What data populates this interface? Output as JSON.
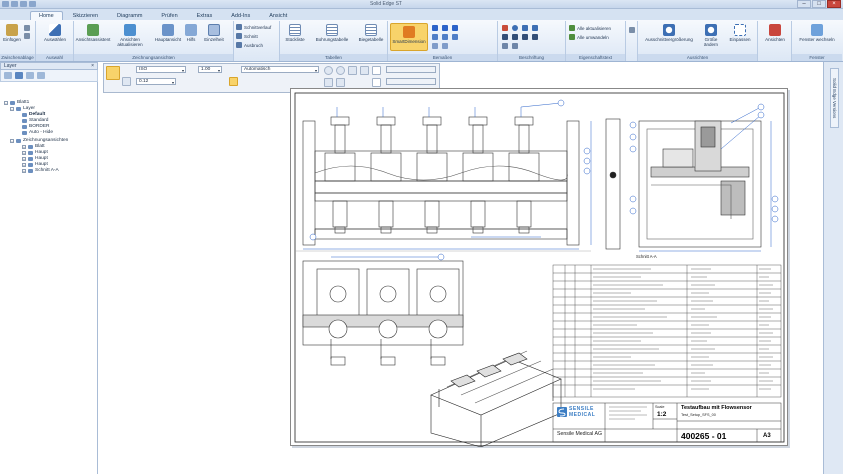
{
  "window": {
    "title": "Solid Edge ST"
  },
  "ribbon": {
    "tabs": [
      "Home",
      "Skizzieren",
      "Diagramm",
      "Prüfen",
      "Extras",
      "Add-Ins",
      "Ansicht"
    ],
    "active_tab": "Home",
    "groups": {
      "zwischenablage": "Zwischenablage",
      "auswahl": "Auswahl",
      "zeichnungsansichten": "Zeichnungsansichten",
      "tabellen": "Tabellen",
      "bemassung": "Bemaßen",
      "beschriftung": "Beschriftung",
      "eigenschaftstext": "Eigenschaftstext",
      "ausrichten": "Ausrichten",
      "fenster": "Fenster"
    },
    "buttons": {
      "einfuegen": "Einfügen",
      "auswahlen": "Auswählen",
      "ansichtsassistent": "Ansichtsassistent",
      "ansichten_aktualisieren": "Ansichten aktualisieren",
      "hauptansicht": "Hauptansicht",
      "hilfs": "Hilfs",
      "einzelheit": "Einzelheit",
      "schnittverlauf": "Schnittverlauf",
      "schnitt": "Schnitt",
      "ausbruch": "Ausbruch",
      "stueckliste": "Stückliste",
      "bohrungstabelle": "Bohrungstabelle",
      "biegetabelle": "Biegetabelle",
      "smartdimension": "SmartDimension",
      "alle_aktualisieren": "Alle aktualisieren",
      "alle_umwandeln": "Alle umwandeln",
      "ausschnittvergroesserung": "Ausschnittvergrößerung",
      "groesse_aendern": "Größe ändern",
      "einpassen": "Einpassen",
      "ansichten": "Ansichten",
      "fenster_wechseln": "Fenster wechseln"
    }
  },
  "layer_panel": {
    "title": "Layer",
    "close": "×",
    "tree": [
      {
        "label": "Blatt1",
        "level": 0
      },
      {
        "label": "Layer",
        "level": 1
      },
      {
        "label": "Default",
        "level": 2,
        "bold": true
      },
      {
        "label": "Standard",
        "level": 2
      },
      {
        "label": "BORDER",
        "level": 2
      },
      {
        "label": "Auto - Hide",
        "level": 2
      },
      {
        "label": "Zeichnungsansichten",
        "level": 1
      },
      {
        "label": "Blatt",
        "level": 2
      },
      {
        "label": "Haupt",
        "level": 2
      },
      {
        "label": "Haupt",
        "level": 2
      },
      {
        "label": "Haupt",
        "level": 2
      },
      {
        "label": "Schnitt A-A",
        "level": 2
      }
    ]
  },
  "property_bar": {
    "style": "ISO",
    "line_width": "1.00",
    "mode": "Automatisch",
    "size": "0.12"
  },
  "right_dock": {
    "label": "Solid Edge Versions"
  },
  "drawing": {
    "section_label": "Schnitt A-A",
    "title": "Testaufbau mit Flowsensor",
    "subtitle": "Test_Setup_SFS_00",
    "scale_label": "Scale",
    "scale": "1:2",
    "drawing_number": "400265 - 01",
    "sheet_size": "A3",
    "company": "Sensile Medical AG",
    "logo_line1": "SENSILE",
    "logo_line2": "MEDICAL",
    "logo_icon": "sensile-s-logo"
  },
  "colors": {
    "ribbon_top": "#f6f9fd",
    "ribbon_bottom": "#dce7f5",
    "accent": "#f8d36a",
    "dim_line": "#2a62c9",
    "logo_blue": "#3c7ec4"
  }
}
